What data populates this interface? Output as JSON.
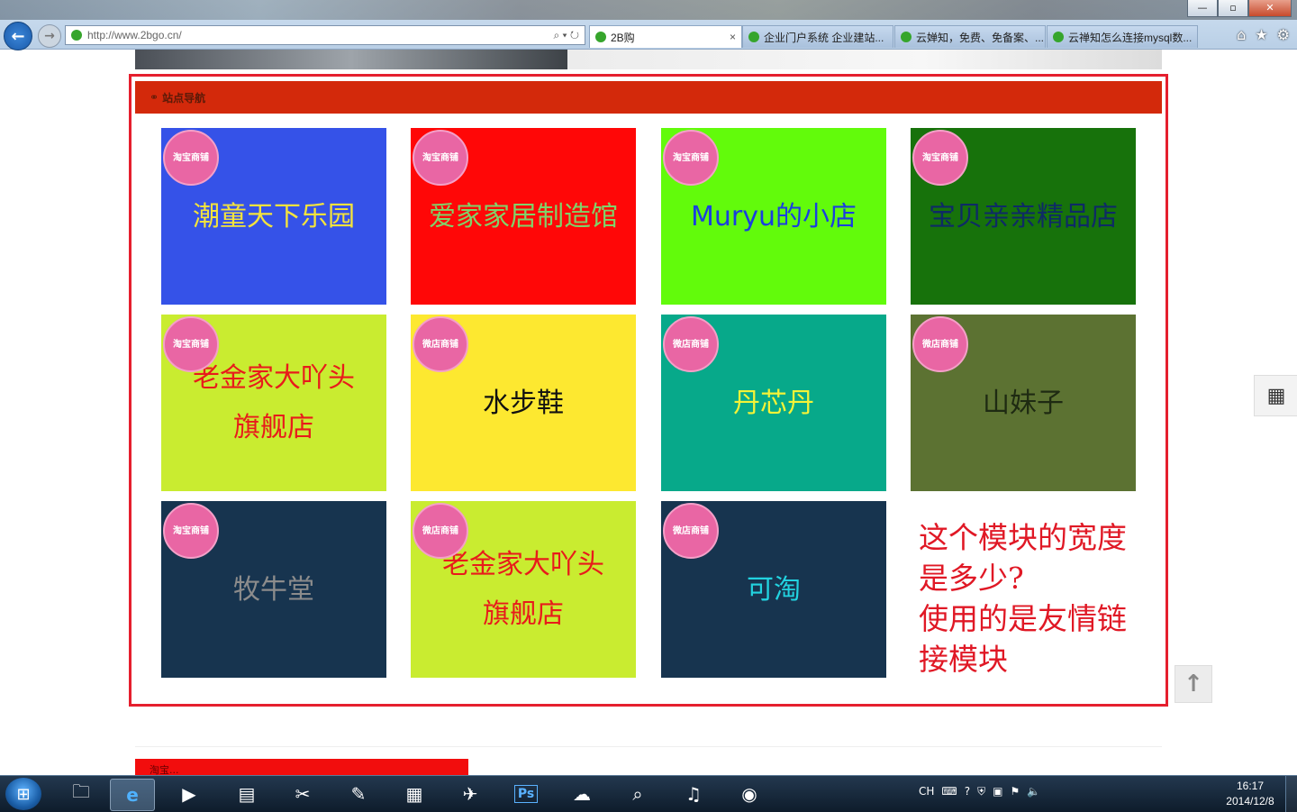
{
  "browser": {
    "window_controls": {
      "minimize": "—",
      "maximize": "▫",
      "close": "✕"
    },
    "address": "http://www.2bgo.cn/",
    "tabs": [
      {
        "label": "2B购",
        "active": true
      },
      {
        "label": "企业门户系统 企业建站...",
        "active": false
      },
      {
        "label": "云婵知，免费、免备案、...",
        "active": false
      },
      {
        "label": "云禅知怎么连接mysql数...",
        "active": false
      }
    ]
  },
  "section": {
    "title": "站点导航"
  },
  "tiles": [
    {
      "badge": "淘宝商铺",
      "name": "潮童天下乐园",
      "bg": "#3552e8",
      "color": "#f4e33c"
    },
    {
      "badge": "淘宝商铺",
      "name": "爱家家居制造馆",
      "bg": "#ff0707",
      "color": "#7fd36a"
    },
    {
      "badge": "淘宝商铺",
      "name": "Muryu的小店",
      "bg": "#62fb0b",
      "color": "#1a3ee0"
    },
    {
      "badge": "淘宝商铺",
      "name": "宝贝亲亲精品店",
      "bg": "#17720b",
      "color": "#0e2a66"
    },
    {
      "badge": "淘宝商铺",
      "name": "老金家大吖头旗舰店",
      "bg": "#c9ec30",
      "color": "#e81b1b"
    },
    {
      "badge": "微店商铺",
      "name": "水步鞋",
      "bg": "#fde830",
      "color": "#111111"
    },
    {
      "badge": "微店商铺",
      "name": "丹芯丹",
      "bg": "#07a98a",
      "color": "#f4f337"
    },
    {
      "badge": "微店商铺",
      "name": "山妹子",
      "bg": "#5c7232",
      "color": "#1e2a12"
    },
    {
      "badge": "淘宝商铺",
      "name": "牧牛堂",
      "bg": "#17344f",
      "color": "#8c8c8c"
    },
    {
      "badge": "微店商铺",
      "name": "老金家大吖头旗舰店",
      "bg": "#c9ec30",
      "color": "#e81b1b"
    },
    {
      "badge": "微店商铺",
      "name": "可淘",
      "bg": "#17344f",
      "color": "#22d3e0"
    }
  ],
  "annotation": {
    "line1": "这个模块的宽度",
    "line2": "是多少?",
    "line3": "使用的是友情链",
    "line4": "接模块"
  },
  "next_section": {
    "title": "淘宝..."
  },
  "taskbar": {
    "tray_lang": "CH",
    "time": "16:17",
    "date": "2014/12/8"
  }
}
